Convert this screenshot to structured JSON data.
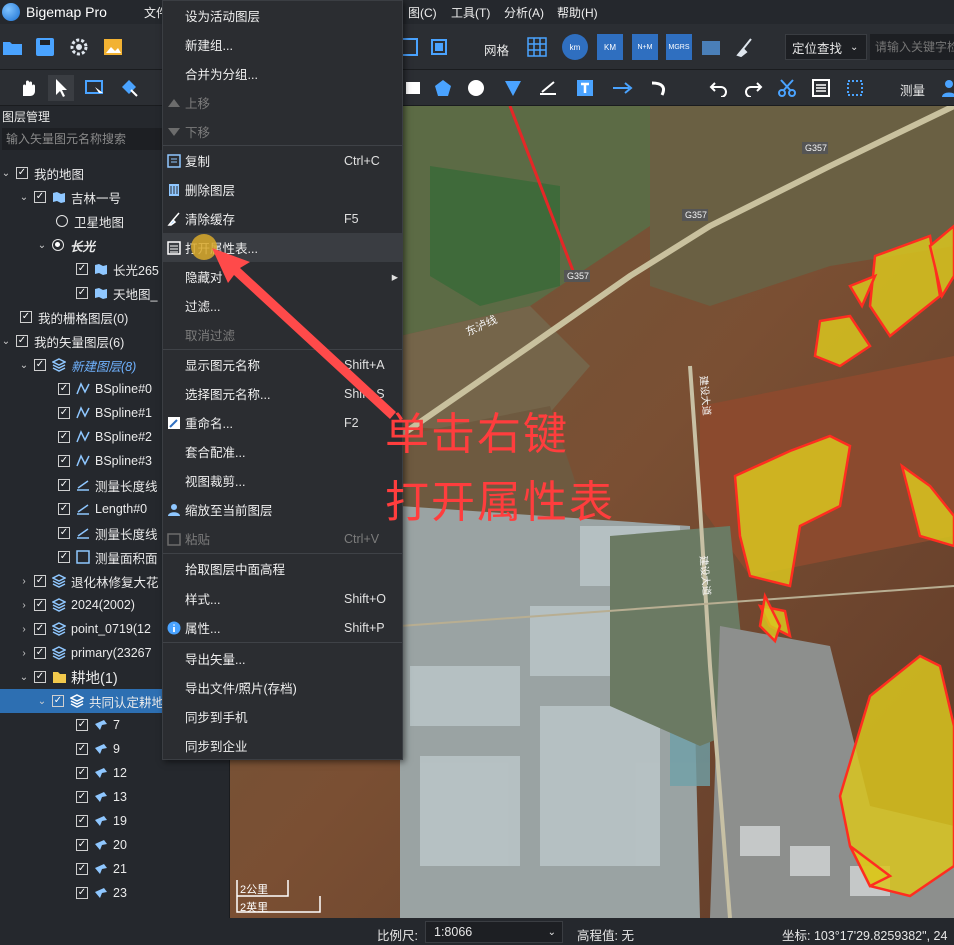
{
  "app": {
    "title": "Bigemap Pro"
  },
  "menubar": {
    "items": [
      "文件(F)",
      "图(C)",
      "工具(T)",
      "分析(A)",
      "帮助(H)"
    ]
  },
  "toolbar": {
    "grid_label": "网格",
    "locate_label": "定位查找",
    "search_placeholder": "请输入关键字检",
    "measure_label": "测量",
    "scale_icons": [
      "km",
      "KM",
      "N+M",
      "MGRS"
    ]
  },
  "layers_panel": {
    "title": "图层管理",
    "search_placeholder": "输入矢量图元名称搜索",
    "rows": [
      {
        "label": "我的地图"
      },
      {
        "label": "吉林一号"
      },
      {
        "label": "卫星地图"
      },
      {
        "label": "长光"
      },
      {
        "label": "长光265"
      },
      {
        "label": "天地图_"
      },
      {
        "label": "我的栅格图层(0)"
      },
      {
        "label": "我的矢量图层(6)"
      },
      {
        "label": "新建图层(8)"
      },
      {
        "label": "BSpline#0"
      },
      {
        "label": "BSpline#1"
      },
      {
        "label": "BSpline#2"
      },
      {
        "label": "BSpline#3"
      },
      {
        "label": "测量长度线"
      },
      {
        "label": "Length#0"
      },
      {
        "label": "测量长度线"
      },
      {
        "label": "测量面积面"
      },
      {
        "label": "退化林修复大花"
      },
      {
        "label": "2024(2002)"
      },
      {
        "label": "point_0719(12"
      },
      {
        "label": "primary(23267"
      },
      {
        "label": "耕地(1)"
      },
      {
        "label": "共同认定耕地"
      },
      {
        "label": "7"
      },
      {
        "label": "9"
      },
      {
        "label": "12"
      },
      {
        "label": "13"
      },
      {
        "label": "19"
      },
      {
        "label": "20"
      },
      {
        "label": "21"
      },
      {
        "label": "23"
      }
    ]
  },
  "context_menu": {
    "items": [
      {
        "label": "设为活动图层",
        "shortcut": ""
      },
      {
        "label": "新建组...",
        "shortcut": ""
      },
      {
        "label": "合并为分组...",
        "shortcut": ""
      },
      {
        "label": "上移",
        "shortcut": ""
      },
      {
        "label": "下移",
        "shortcut": ""
      },
      {
        "label": "复制",
        "shortcut": "Ctrl+C"
      },
      {
        "label": "删除图层",
        "shortcut": ""
      },
      {
        "label": "清除缓存",
        "shortcut": "F5"
      },
      {
        "label": "打开属性表...",
        "shortcut": ""
      },
      {
        "label": "隐藏对",
        "shortcut": ""
      },
      {
        "label": "过滤...",
        "shortcut": ""
      },
      {
        "label": "取消过滤",
        "shortcut": ""
      },
      {
        "label": "显示图元名称",
        "shortcut": "Shift+A"
      },
      {
        "label": "选择图元名称...",
        "shortcut": "Shift+S"
      },
      {
        "label": "重命名...",
        "shortcut": "F2"
      },
      {
        "label": "套合配准...",
        "shortcut": ""
      },
      {
        "label": "视图裁剪...",
        "shortcut": ""
      },
      {
        "label": "缩放至当前图层",
        "shortcut": ""
      },
      {
        "label": "粘贴",
        "shortcut": "Ctrl+V"
      },
      {
        "label": "拾取图层中面高程",
        "shortcut": ""
      },
      {
        "label": "样式...",
        "shortcut": "Shift+O"
      },
      {
        "label": "属性...",
        "shortcut": "Shift+P"
      },
      {
        "label": "导出矢量...",
        "shortcut": ""
      },
      {
        "label": "导出文件/照片(存档)",
        "shortcut": ""
      },
      {
        "label": "同步到手机",
        "shortcut": ""
      },
      {
        "label": "同步到企业",
        "shortcut": ""
      }
    ]
  },
  "annotation": {
    "line1": "单击右键",
    "line2": "打开属性表",
    "color": "#ff3d3d"
  },
  "map": {
    "road_labels": [
      "G357",
      "G357",
      "G357",
      "东泸线",
      "建设大道",
      "建设大道"
    ],
    "scale_bar": {
      "km": "2公里",
      "mi": "2英里"
    }
  },
  "statusbar": {
    "scale_label": "比例尺:",
    "scale_value": "1:8066",
    "elevation_label": "高程值: 无",
    "coord_label": "坐标: 103°17'29.8259382\", 24"
  }
}
